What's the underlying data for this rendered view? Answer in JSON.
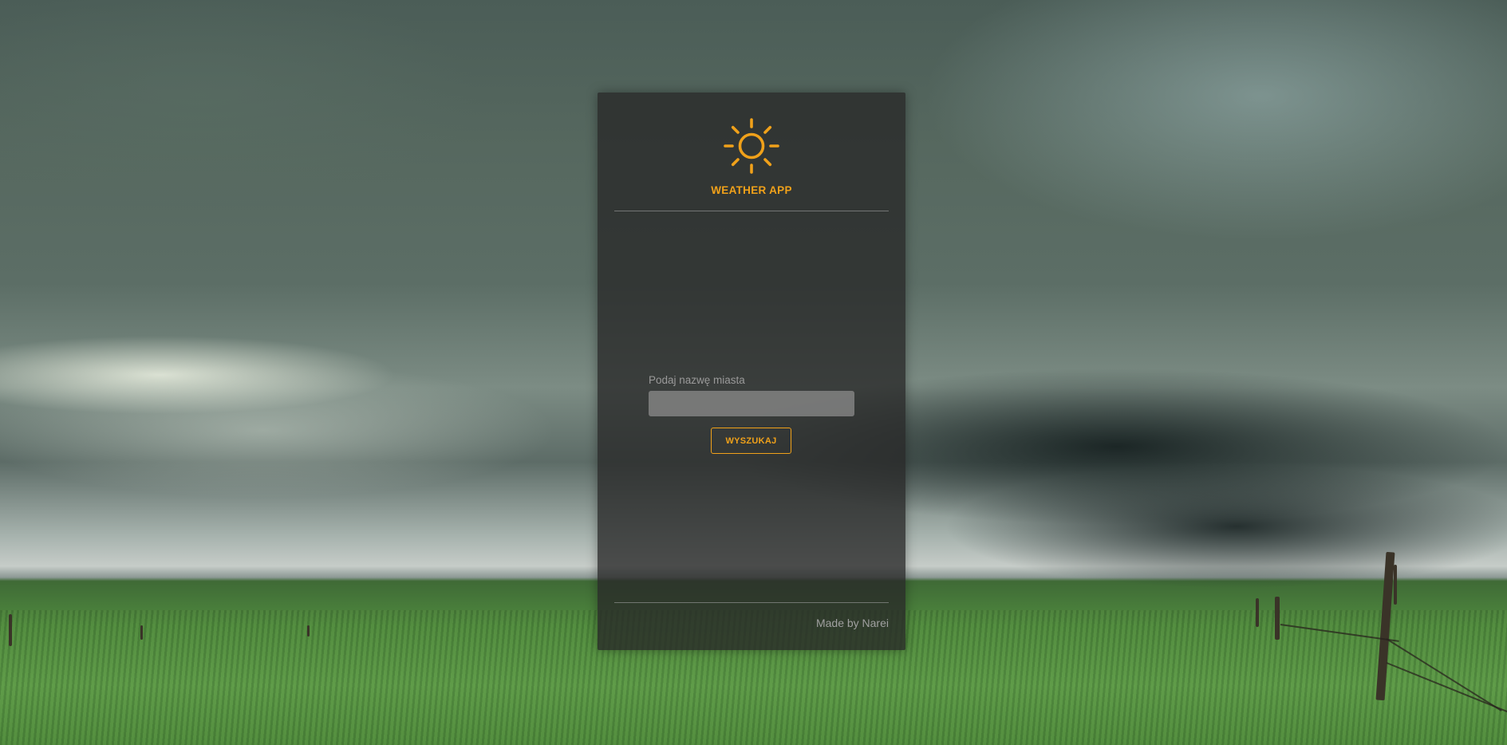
{
  "app": {
    "title": "WEATHER APP",
    "logo_icon": "sun-icon",
    "accent_color": "#f0a11a"
  },
  "search": {
    "label": "Podaj nazwę miasta",
    "value": "",
    "placeholder": "",
    "button_label": "WYSZUKAJ"
  },
  "footer": {
    "credit": "Made by Narei"
  },
  "background": {
    "subject": "storm-clouds-over-grassland"
  }
}
